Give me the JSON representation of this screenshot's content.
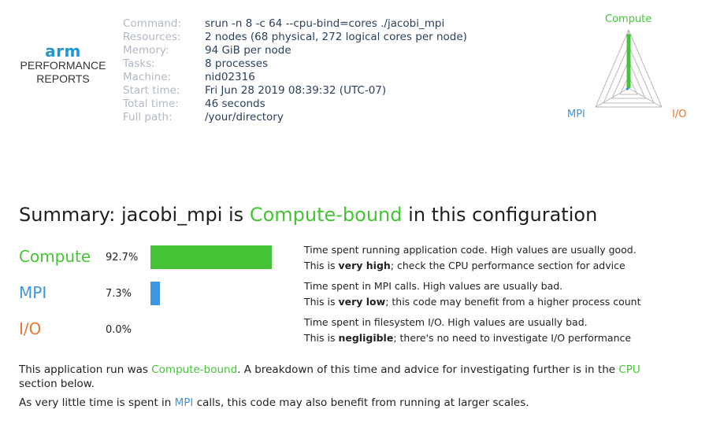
{
  "logo": {
    "brand": "arm",
    "line1": "PERFORMANCE",
    "line2": "REPORTS"
  },
  "meta": [
    {
      "key": "Command:",
      "value": "srun -n 8 -c 64 --cpu-bind=cores ./jacobi_mpi"
    },
    {
      "key": "Resources:",
      "value": "2 nodes (68 physical, 272 logical cores per node)"
    },
    {
      "key": "Memory:",
      "value": "94 GiB per node"
    },
    {
      "key": "Tasks:",
      "value": "8 processes"
    },
    {
      "key": "Machine:",
      "value": "nid02316"
    },
    {
      "key": "Start time:",
      "value": "Fri Jun 28 2019 08:39:32 (UTC-07)"
    },
    {
      "key": "Total time:",
      "value": "46 seconds"
    },
    {
      "key": "Full path:",
      "value": "/your/directory"
    }
  ],
  "radar": {
    "labels": {
      "compute": "Compute",
      "mpi": "MPI",
      "io": "I/O"
    },
    "values": {
      "compute": 0.927,
      "mpi": 0.073,
      "io": 0.0
    }
  },
  "summary": {
    "prefix": "Summary: jacobi_mpi is ",
    "highlight": "Compute-bound",
    "suffix": " in this configuration"
  },
  "metrics": [
    {
      "name": "Compute",
      "pct_text": "92.7%",
      "fraction": 0.927,
      "desc1": "Time spent running application code. High values are usually good.",
      "desc2_pre": "This is ",
      "desc2_bold": "very high",
      "desc2_post": "; check the CPU performance section for advice"
    },
    {
      "name": "MPI",
      "pct_text": "7.3%",
      "fraction": 0.073,
      "desc1": "Time spent in MPI calls. High values are usually bad.",
      "desc2_pre": "This is ",
      "desc2_bold": "very low",
      "desc2_post": "; this code may benefit from a higher process count"
    },
    {
      "name": "I/O",
      "pct_text": "0.0%",
      "fraction": 0.0,
      "desc1": "Time spent in filesystem I/O. High values are usually bad.",
      "desc2_pre": "This is ",
      "desc2_bold": "negligible",
      "desc2_post": "; there's no need to investigate I/O performance"
    }
  ],
  "paragraph1": {
    "a": "This application run was ",
    "b": "Compute-bound",
    "c": ". A breakdown of this time and advice for investigating further is in the ",
    "d": "CPU",
    "e": " section below."
  },
  "paragraph2": {
    "a": "As very little time is spent in ",
    "b": "MPI",
    "c": " calls, this code may also benefit from running at larger scales."
  },
  "colors": {
    "compute": "#44c434",
    "mpi": "#3d97e0",
    "io": "#e8742e"
  }
}
